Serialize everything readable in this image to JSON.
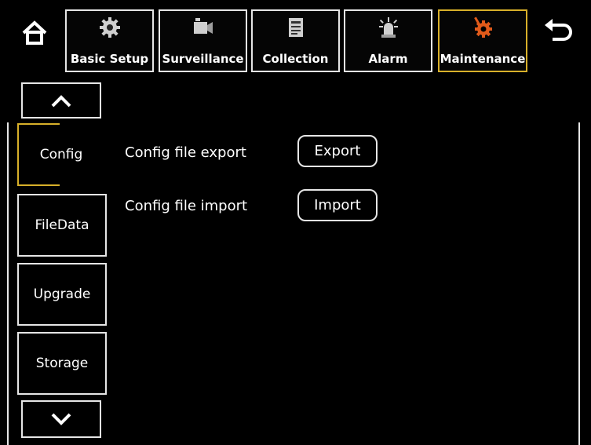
{
  "top_nav": {
    "tabs": [
      {
        "label": "Basic Setup",
        "icon": "gear-icon"
      },
      {
        "label": "Surveillance",
        "icon": "camera-icon"
      },
      {
        "label": "Collection",
        "icon": "document-icon"
      },
      {
        "label": "Alarm",
        "icon": "siren-icon"
      },
      {
        "label": "Maintenance",
        "icon": "gear-orange-icon"
      }
    ],
    "active_tab": "Maintenance",
    "home_icon": "home-icon",
    "back_icon": "back-arrow-icon"
  },
  "side_nav": {
    "up_icon": "chevron-up-icon",
    "down_icon": "chevron-down-icon",
    "items": [
      {
        "label": "Config"
      },
      {
        "label": "FileData"
      },
      {
        "label": "Upgrade"
      },
      {
        "label": "Storage"
      }
    ],
    "active_item": "Config"
  },
  "content": {
    "rows": [
      {
        "label": "Config file export",
        "button": "Export"
      },
      {
        "label": "Config file import",
        "button": "Import"
      }
    ]
  },
  "colors": {
    "background": "#000000",
    "active_border": "#d8b02a",
    "border": "#e6e6e6",
    "maintenance_icon": "#e05a1a"
  }
}
